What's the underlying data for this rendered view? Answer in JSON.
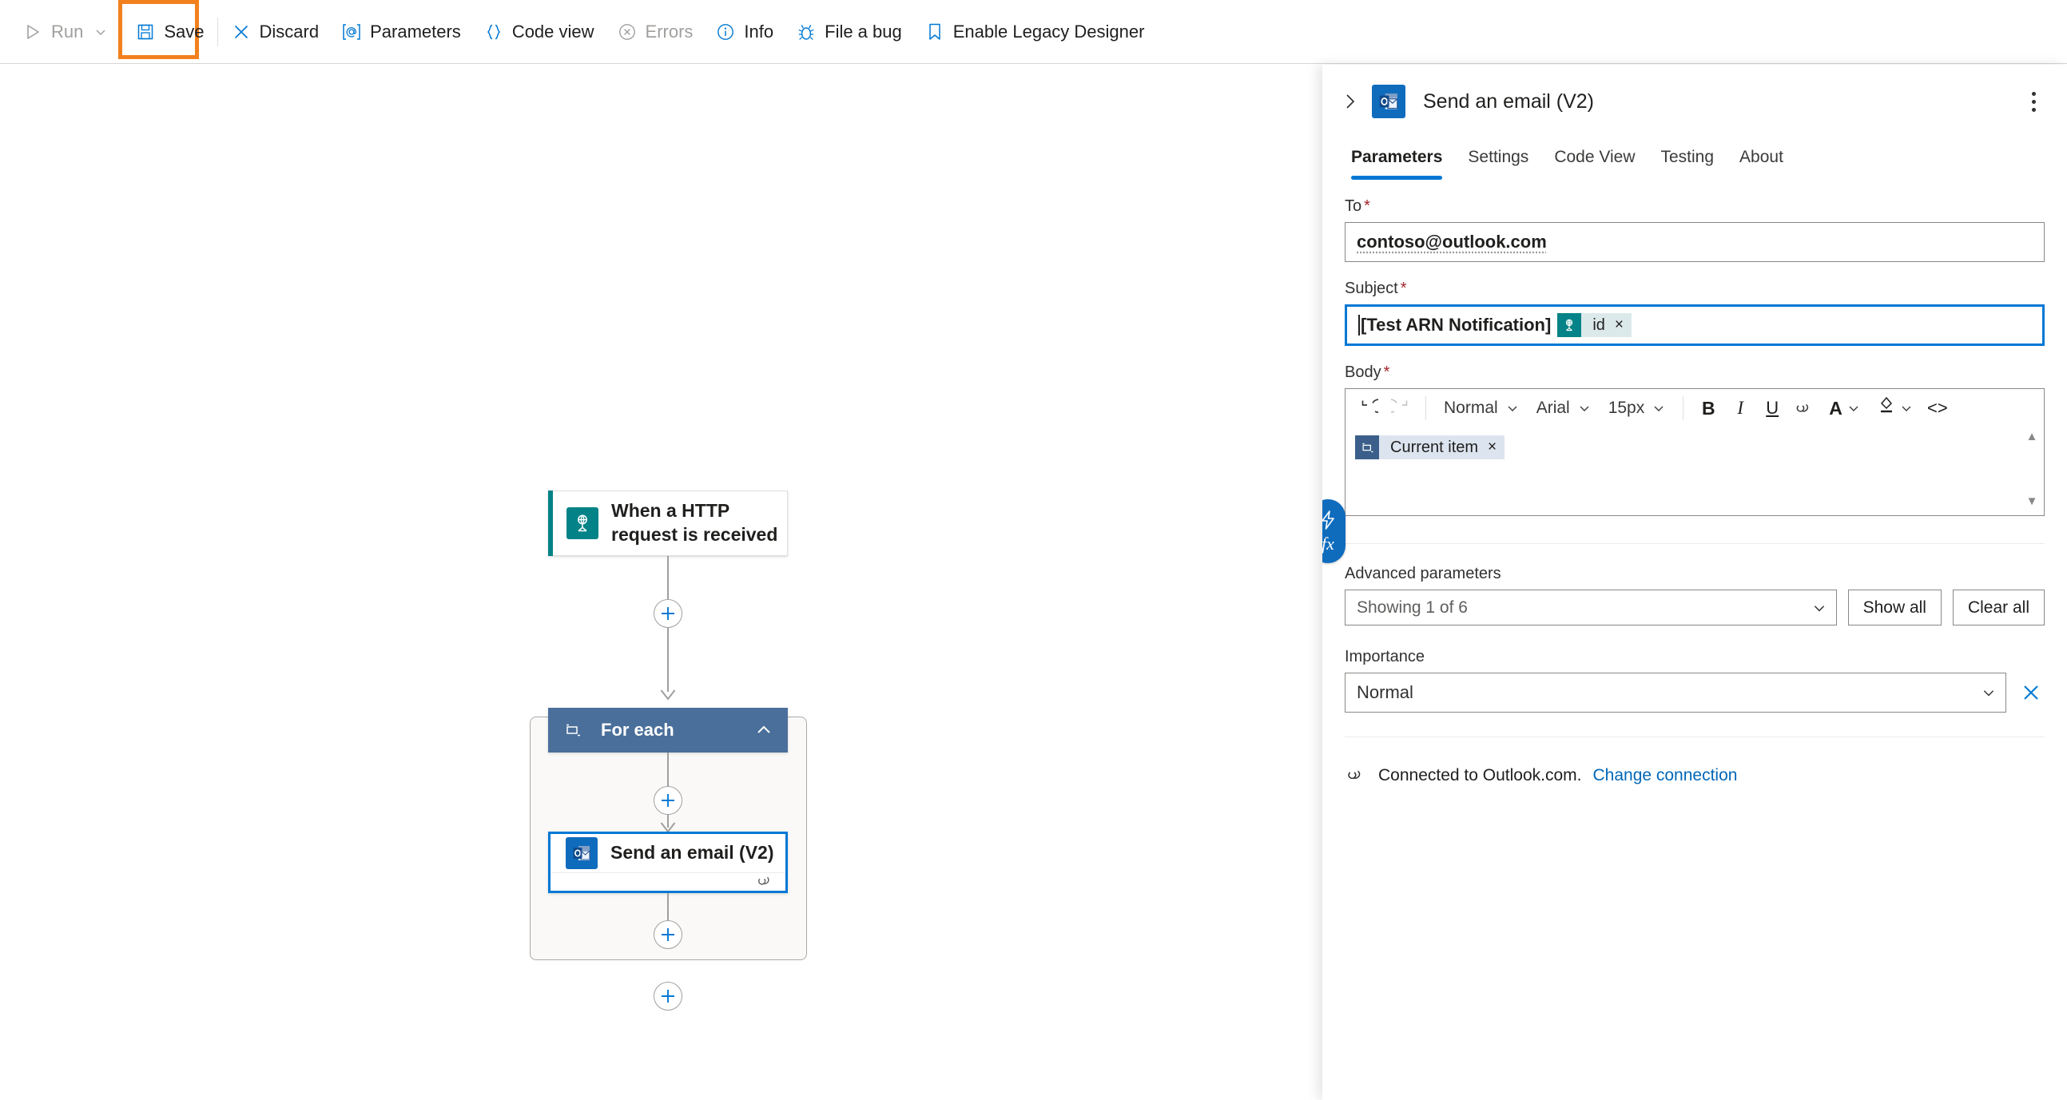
{
  "toolbar": {
    "items": [
      {
        "label": "Run",
        "icon": "play-icon",
        "disabled": true,
        "chevron": true
      },
      {
        "label": "Save",
        "icon": "save-icon",
        "disabled": false,
        "chevron": false,
        "highlighted": true
      },
      {
        "label": "Discard",
        "icon": "discard-icon",
        "disabled": false,
        "chevron": false
      },
      {
        "label": "Parameters",
        "icon": "at-bracket-icon",
        "disabled": false,
        "chevron": false
      },
      {
        "label": "Code view",
        "icon": "curly-braces-icon",
        "disabled": false,
        "chevron": false
      },
      {
        "label": "Errors",
        "icon": "error-circle-icon",
        "disabled": true,
        "chevron": false
      },
      {
        "label": "Info",
        "icon": "info-circle-icon",
        "disabled": false,
        "chevron": false
      },
      {
        "label": "File a bug",
        "icon": "bug-icon",
        "disabled": false,
        "chevron": false
      },
      {
        "label": "Enable Legacy Designer",
        "icon": "bookmark-icon",
        "disabled": false,
        "chevron": false
      }
    ],
    "highlight_color": "#f2811d"
  },
  "canvas": {
    "trigger_node": {
      "title": "When a HTTP request is received",
      "icon": "http-request-icon",
      "accent_color": "#038387"
    },
    "scope_node": {
      "title": "For each",
      "icon": "foreach-loop-icon",
      "header_color": "#4a6f9a",
      "collapse_icon": "chevron-up-icon"
    },
    "action_node": {
      "title": "Send an email (V2)",
      "icon": "outlook-icon",
      "selected": true,
      "footer_icon": "connection-link-icon",
      "border_color": "#0078d4"
    },
    "add_buttons": [
      "add-step-after-trigger",
      "add-step-inside-foreach-top",
      "add-step-inside-foreach-bottom",
      "add-step-after-foreach"
    ]
  },
  "panel": {
    "collapse_icon": "chevron-right-icon",
    "icon": "outlook-icon",
    "title": "Send an email (V2)",
    "kebab_icon": "more-vertical-icon",
    "tabs": [
      {
        "label": "Parameters",
        "active": true
      },
      {
        "label": "Settings",
        "active": false
      },
      {
        "label": "Code View",
        "active": false
      },
      {
        "label": "Testing",
        "active": false
      },
      {
        "label": "About",
        "active": false
      }
    ],
    "accent_color": "#0078d4",
    "dynamic_content_button": {
      "name": "dynamic-content-and-expression-button",
      "lightning_glyph": "⚡",
      "fx_glyph": "fx"
    },
    "fields": {
      "to": {
        "label": "To",
        "required": true,
        "value": "contoso@outlook.com"
      },
      "subject": {
        "label": "Subject",
        "required": true,
        "text": "[Test ARN Notification]",
        "focused": true,
        "token": {
          "label": "id",
          "icon": "http-request-icon",
          "remove_glyph": "×",
          "icon_color": "#038387",
          "body_color": "#dce9ea"
        }
      },
      "body": {
        "label": "Body",
        "required": true,
        "toolbar": {
          "undo": {
            "name": "undo-icon",
            "label": ""
          },
          "redo": {
            "name": "redo-icon",
            "label": ""
          },
          "style": "Normal",
          "font": "Arial",
          "size": "15px",
          "bold": "B",
          "italic": "I",
          "underline": "U",
          "link": "link-icon",
          "font_color": "A",
          "highlight_color": "highlighter-icon",
          "code": "<>"
        },
        "token": {
          "label": "Current item",
          "icon": "foreach-loop-icon",
          "remove_glyph": "×",
          "icon_color": "#3b5f8a",
          "body_color": "#dce4ef"
        },
        "scroll_up": "▲",
        "scroll_down": "▼"
      }
    },
    "advanced": {
      "label": "Advanced parameters",
      "select_value": "Showing 1 of 6",
      "show_all_label": "Show all",
      "clear_all_label": "Clear all"
    },
    "importance": {
      "label": "Importance",
      "value": "Normal",
      "clear_icon": "close-icon"
    },
    "connection": {
      "icon": "connection-link-icon",
      "status_text": "Connected to Outlook.com.",
      "change_link": "Change connection"
    }
  }
}
